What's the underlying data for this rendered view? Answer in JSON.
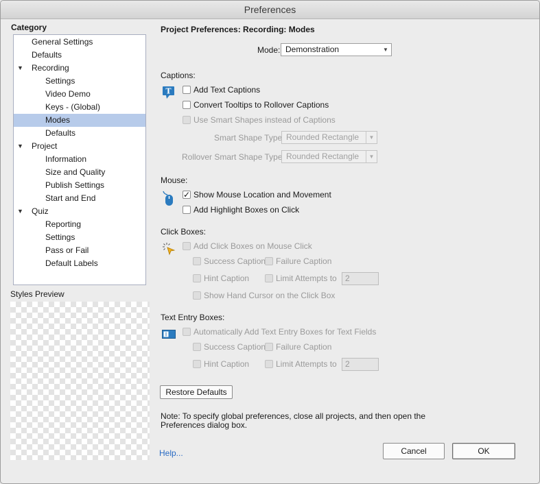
{
  "window": {
    "title": "Preferences"
  },
  "category": {
    "title": "Category",
    "items": [
      {
        "label": "General Settings",
        "level": 0,
        "expander": false
      },
      {
        "label": "Defaults",
        "level": 0,
        "expander": false
      },
      {
        "label": "Recording",
        "level": 0,
        "expander": true
      },
      {
        "label": "Settings",
        "level": 1
      },
      {
        "label": "Video Demo",
        "level": 1
      },
      {
        "label": "Keys - (Global)",
        "level": 1
      },
      {
        "label": "Modes",
        "level": 1,
        "selected": true
      },
      {
        "label": "Defaults",
        "level": 1
      },
      {
        "label": "Project",
        "level": 0,
        "expander": true
      },
      {
        "label": "Information",
        "level": 1
      },
      {
        "label": "Size and Quality",
        "level": 1
      },
      {
        "label": "Publish Settings",
        "level": 1
      },
      {
        "label": "Start and End",
        "level": 1
      },
      {
        "label": "Quiz",
        "level": 0,
        "expander": true
      },
      {
        "label": "Reporting",
        "level": 1
      },
      {
        "label": "Settings",
        "level": 1
      },
      {
        "label": "Pass or Fail",
        "level": 1
      },
      {
        "label": "Default Labels",
        "level": 1
      }
    ]
  },
  "styles_preview": {
    "label": "Styles Preview"
  },
  "main": {
    "heading": "Project Preferences: Recording: Modes",
    "mode": {
      "label": "Mode:",
      "value": "Demonstration"
    },
    "captions": {
      "label": "Captions:",
      "add_text_captions": "Add Text Captions",
      "convert_tooltips": "Convert Tooltips to Rollover Captions",
      "use_smart_shapes": "Use Smart Shapes instead of Captions",
      "smart_shape_type_label": "Smart Shape Type",
      "smart_shape_type_value": "Rounded Rectangle",
      "rollover_shape_type_label": "Rollover Smart Shape Type",
      "rollover_shape_type_value": "Rounded Rectangle"
    },
    "mouse": {
      "label": "Mouse:",
      "show_mouse": "Show Mouse Location and Movement",
      "add_highlight": "Add Highlight Boxes on Click"
    },
    "click_boxes": {
      "label": "Click Boxes:",
      "add_click_boxes": "Add Click Boxes on Mouse Click",
      "success_caption": "Success Caption",
      "failure_caption": "Failure Caption",
      "hint_caption": "Hint Caption",
      "limit_attempts": "Limit Attempts to",
      "limit_value": "2",
      "show_hand_cursor": "Show Hand Cursor on the Click Box"
    },
    "text_entry": {
      "label": "Text Entry Boxes:",
      "auto_add": "Automatically Add Text Entry Boxes for Text Fields",
      "success_caption": "Success Caption",
      "failure_caption": "Failure Caption",
      "hint_caption": "Hint Caption",
      "limit_attempts": "Limit Attempts to",
      "limit_value": "2"
    },
    "restore_defaults": "Restore Defaults",
    "note": "Note: To specify global preferences, close all projects, and then open the Preferences dialog box."
  },
  "footer": {
    "help": "Help...",
    "cancel": "Cancel",
    "ok": "OK"
  },
  "colors": {
    "selection": "#b7cbea",
    "link": "#2a6bc4",
    "icon_blue": "#2b7bbf"
  }
}
